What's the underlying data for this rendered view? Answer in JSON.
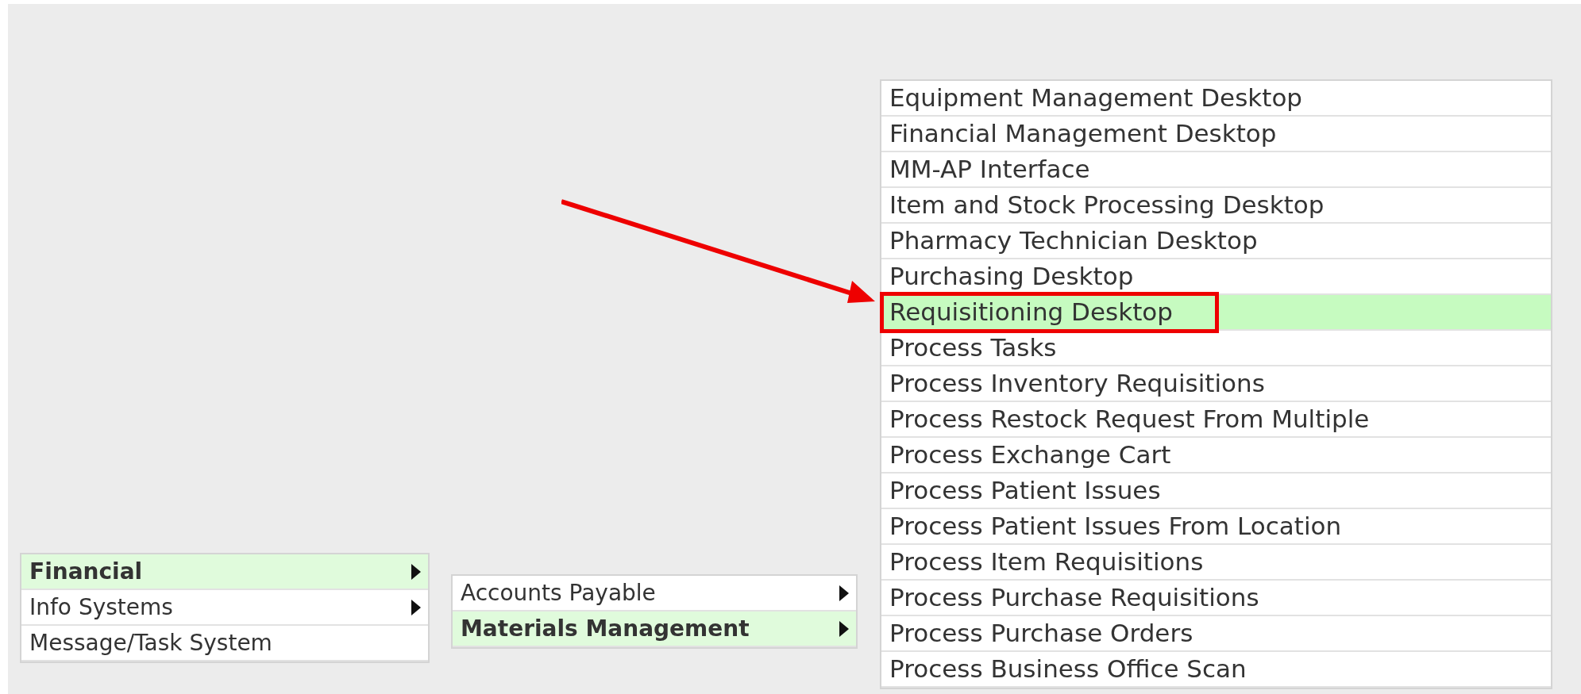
{
  "menus": [
    {
      "items": [
        {
          "label": "Financial",
          "selected": true,
          "has_submenu": true
        },
        {
          "label": "Info Systems",
          "selected": false,
          "has_submenu": true
        },
        {
          "label": "Message/Task System",
          "selected": false,
          "has_submenu": false
        }
      ]
    },
    {
      "items": [
        {
          "label": "Accounts Payable",
          "selected": false,
          "has_submenu": true
        },
        {
          "label": "Materials Management",
          "selected": true,
          "has_submenu": true
        }
      ]
    },
    {
      "items": [
        {
          "label": "Equipment Management Desktop",
          "selected": false,
          "has_submenu": false
        },
        {
          "label": "Financial Management Desktop",
          "selected": false,
          "has_submenu": false
        },
        {
          "label": "MM-AP Interface",
          "selected": false,
          "has_submenu": false
        },
        {
          "label": "Item and Stock Processing Desktop",
          "selected": false,
          "has_submenu": false
        },
        {
          "label": "Pharmacy Technician Desktop",
          "selected": false,
          "has_submenu": false
        },
        {
          "label": "Purchasing Desktop",
          "selected": false,
          "has_submenu": false
        },
        {
          "label": "Requisitioning Desktop",
          "selected": true,
          "has_submenu": false
        },
        {
          "label": "Process Tasks",
          "selected": false,
          "has_submenu": false
        },
        {
          "label": "Process Inventory Requisitions",
          "selected": false,
          "has_submenu": false
        },
        {
          "label": "Process Restock Request From Multiple",
          "selected": false,
          "has_submenu": false
        },
        {
          "label": "Process Exchange Cart",
          "selected": false,
          "has_submenu": false
        },
        {
          "label": "Process Patient Issues",
          "selected": false,
          "has_submenu": false
        },
        {
          "label": "Process Patient Issues From Location",
          "selected": false,
          "has_submenu": false
        },
        {
          "label": "Process Item Requisitions",
          "selected": false,
          "has_submenu": false
        },
        {
          "label": "Process Purchase Requisitions",
          "selected": false,
          "has_submenu": false
        },
        {
          "label": "Process Purchase Orders",
          "selected": false,
          "has_submenu": false
        },
        {
          "label": "Process Business Office Scan",
          "selected": false,
          "has_submenu": false
        }
      ]
    }
  ]
}
